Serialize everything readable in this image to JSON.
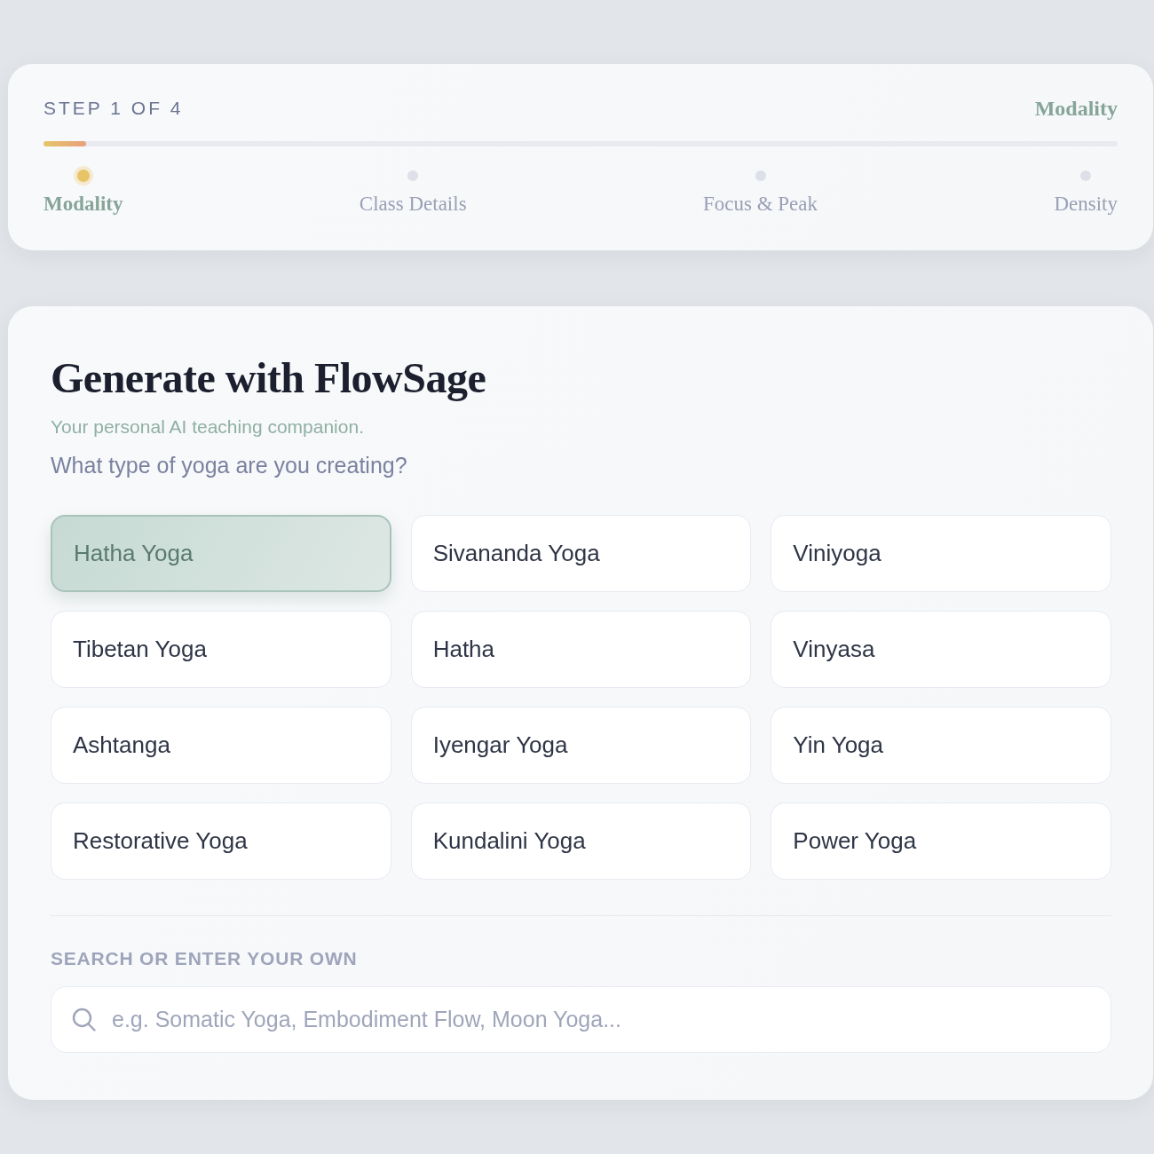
{
  "progress": {
    "step_label": "STEP 1 OF 4",
    "current_step": "Modality",
    "level": 0.04,
    "steps": [
      {
        "label": "Modality",
        "selected": true
      },
      {
        "label": "Class Details",
        "selected": false
      },
      {
        "label": "Focus & Peak",
        "selected": false
      },
      {
        "label": "Density",
        "selected": false
      }
    ]
  },
  "generator": {
    "title": "Generate with FlowSage",
    "subtitle": "Your personal AI teaching companion.",
    "question": "What type of yoga are you creating?",
    "options": [
      {
        "label": "Hatha Yoga",
        "selected": true
      },
      {
        "label": "Sivananda Yoga",
        "selected": false
      },
      {
        "label": "Viniyoga",
        "selected": false
      },
      {
        "label": "Tibetan Yoga",
        "selected": false
      },
      {
        "label": "Hatha",
        "selected": false
      },
      {
        "label": "Vinyasa",
        "selected": false
      },
      {
        "label": "Ashtanga",
        "selected": false
      },
      {
        "label": "Iyengar Yoga",
        "selected": false
      },
      {
        "label": "Yin Yoga",
        "selected": false
      },
      {
        "label": "Restorative Yoga",
        "selected": false
      },
      {
        "label": "Kundalini Yoga",
        "selected": false
      },
      {
        "label": "Power Yoga",
        "selected": false
      }
    ]
  },
  "search": {
    "label": "SEARCH OR ENTER YOUR OWN",
    "placeholder": "e.g. Somatic Yoga, Embodiment Flow, Moon Yoga..."
  }
}
